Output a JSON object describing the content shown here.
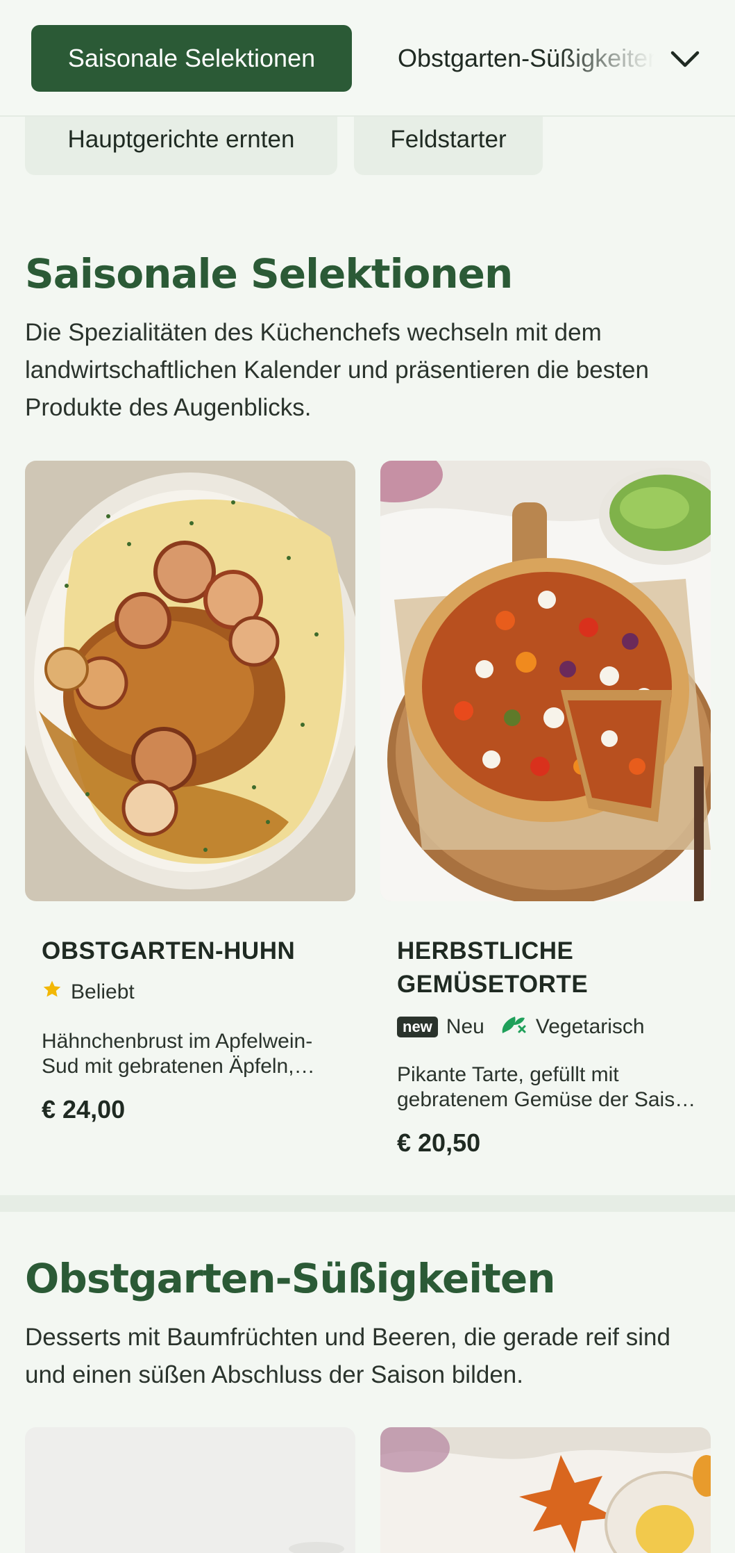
{
  "nav": {
    "active_tab": "Saisonale Selektionen",
    "next_tab": "Obstgarten-Süßigkeiten",
    "pills": [
      "Hauptgerichte ernten",
      "Feldstarter"
    ]
  },
  "sections": [
    {
      "title": "Saisonale Selektionen",
      "description": "Die Spezialitäten des Küchenchefs wechseln mit dem landwirtschaftlichen Kalender und präsentieren die besten Produkte des Augenblicks.",
      "items": [
        {
          "name": "OBSTGARTEN-HUHN",
          "badges": [
            {
              "icon": "star-icon",
              "label": "Beliebt"
            }
          ],
          "description": "Hähnchenbrust im Apfelwein-Sud mit gebratenen Äpfeln, Kartoffelpüree und frischen Kräutern.",
          "price": "€ 24,00"
        },
        {
          "name": "HERBSTLICHE GEMÜSETORTE",
          "badges": [
            {
              "icon": "new-icon",
              "tag": "new",
              "label": "Neu"
            },
            {
              "icon": "vegetarian-icon",
              "label": "Vegetarisch"
            }
          ],
          "description": "Pikante Tarte, gefüllt mit gebratenem Gemüse der Saison und Ziegenkäse.",
          "price": "€ 20,50"
        }
      ]
    },
    {
      "title": "Obstgarten-Süßigkeiten",
      "description": "Desserts mit Baumfrüchten und Beeren, die gerade reif sind und einen süßen Abschluss der Saison bilden."
    }
  ],
  "colors": {
    "accent": "#2b5a36",
    "background": "#f3f7f2",
    "pill_background": "#e7eee6",
    "star": "#f2b705",
    "vegetarian": "#1fa05a"
  }
}
